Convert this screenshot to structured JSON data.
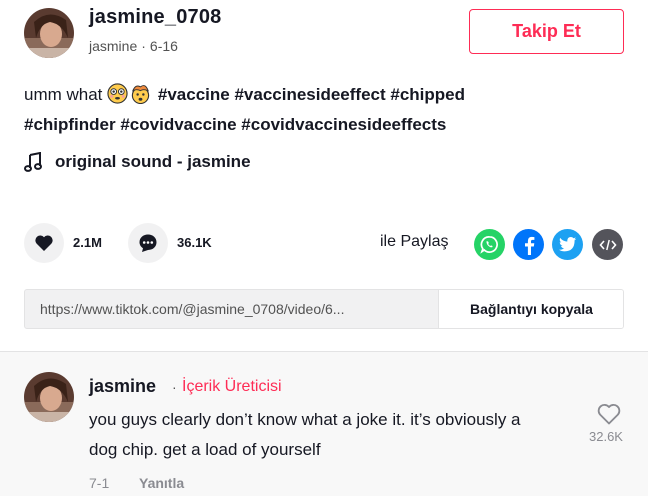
{
  "post": {
    "username": "jasmine_0708",
    "display_name": "jasmine",
    "date": "6-16",
    "follow_label": "Takip Et",
    "caption_text": "umm what",
    "hashtags_line1": "#vaccine #vaccinesideeffect #chipped",
    "hashtags_line2": "#chipfinder #covidvaccine #covidvaccinesideeffects",
    "emojis": [
      "flushed-face-emoji",
      "exploding-head-emoji"
    ],
    "music": "original sound - jasmine"
  },
  "stats": {
    "likes": "2.1M",
    "comments": "36.1K"
  },
  "share": {
    "label": "ile Paylaş",
    "targets": [
      "whatsapp-icon",
      "facebook-icon",
      "twitter-icon",
      "embed-icon"
    ]
  },
  "link": {
    "url": "https://www.tiktok.com/@jasmine_0708/video/6...",
    "copy_label": "Bağlantıyı kopyala"
  },
  "comment": {
    "username": "jasmine",
    "separator": "·",
    "badge": "İçerik Üreticisi",
    "text": "you guys clearly don’t know what a joke it. it’s obviously a dog chip. get a load of yourself",
    "date": "7-1",
    "reply_label": "Yanıtla",
    "likes": "32.6K"
  },
  "colors": {
    "accent": "#fe2c55",
    "whatsapp": "#25d366",
    "facebook": "#0075fa",
    "twitter": "#1da1f2",
    "embed": "#54545b"
  }
}
